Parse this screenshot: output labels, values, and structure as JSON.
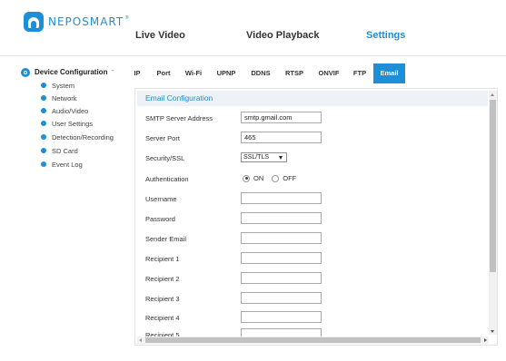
{
  "brand": {
    "name": "NEPOSMART",
    "trademark": "®",
    "color": "#1e8fd6"
  },
  "top_nav": [
    "Live Video",
    "Video Playback",
    "Settings"
  ],
  "sidebar": {
    "title": "Device Configuration",
    "collapse_symbol": "-",
    "items": [
      "System",
      "Network",
      "Audio/Video",
      "User Settings",
      "Detection/Recording",
      "SD Card",
      "Event Log"
    ]
  },
  "tabs": [
    "IP",
    "Port",
    "Wi-Fi",
    "UPNP",
    "DDNS",
    "RTSP",
    "ONVIF",
    "FTP",
    "Email"
  ],
  "active_tab": "Email",
  "email": {
    "section_title": "Email Configuration",
    "labels": {
      "smtp_server": "SMTP Server Address",
      "server_port": "Server Port",
      "security": "Security/SSL",
      "authentication": "Authentication",
      "username": "Username",
      "password": "Password",
      "sender": "Sender Email",
      "recipient1": "Recipient 1",
      "recipient2": "Recipient 2",
      "recipient3": "Recipient 3",
      "recipient4": "Recipient 4",
      "recipient5": "Recipient 5"
    },
    "values": {
      "smtp_server": "smtp.gmail.com",
      "server_port": "465",
      "security": "SSL/TLS",
      "username": "",
      "password": "",
      "sender": "",
      "recipient1": "",
      "recipient2": "",
      "recipient3": "",
      "recipient4": "",
      "recipient5": ""
    },
    "auth_on": "ON",
    "auth_off": "OFF",
    "auth_selected": "ON"
  }
}
